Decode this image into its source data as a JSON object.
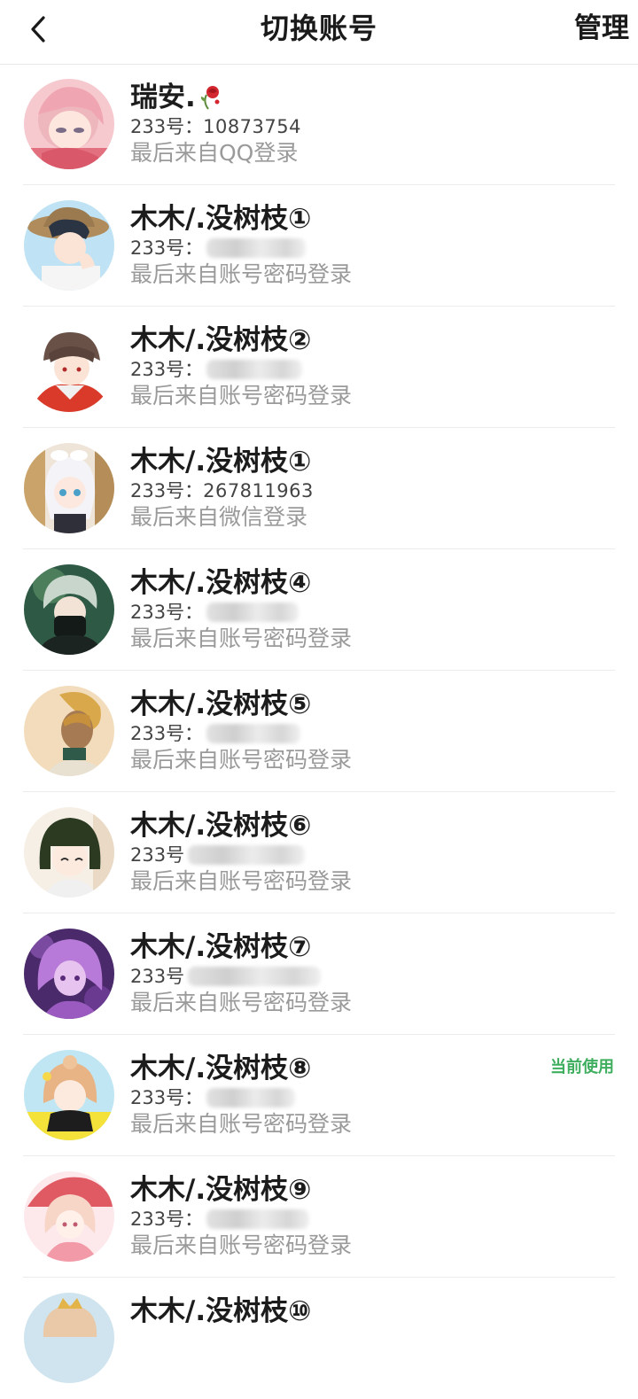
{
  "header": {
    "title": "切换账号",
    "manage_label": "管理",
    "back_icon": "chevron-left-icon"
  },
  "accounts": [
    {
      "name": "瑞安.",
      "name_icon": "rose-icon",
      "uid_label": "233号：",
      "uid": "10873754",
      "uid_masked": false,
      "source": "最后来自QQ登录",
      "avatar": "pink-hair-anime-avatar"
    },
    {
      "name": "木木/.没树枝①",
      "uid_label": "233号：",
      "uid": "",
      "uid_masked": true,
      "source": "最后来自账号密码登录",
      "avatar": "straw-hat-anime-avatar"
    },
    {
      "name": "木木/.没树枝②",
      "uid_label": "233号：",
      "uid": "",
      "uid_masked": true,
      "source": "最后来自账号密码登录",
      "avatar": "red-jacket-anime-avatar"
    },
    {
      "name": "木木/.没树枝①",
      "uid_label": "233号：",
      "uid": "267811963",
      "uid_masked": false,
      "source": "最后来自微信登录",
      "avatar": "white-hair-anime-avatar"
    },
    {
      "name": "木木/.没树枝④",
      "uid_label": "233号：",
      "uid": "",
      "uid_masked": true,
      "source": "最后来自账号密码登录",
      "avatar": "masked-ninja-anime-avatar"
    },
    {
      "name": "木木/.没树枝⑤",
      "uid_label": "233号：",
      "uid": "",
      "uid_masked": true,
      "source": "最后来自账号密码登录",
      "avatar": "blonde-profile-anime-avatar"
    },
    {
      "name": "木木/.没树枝⑥",
      "uid_label": "233号",
      "uid": "",
      "uid_masked": true,
      "source": "最后来自账号密码登录",
      "avatar": "bob-hair-anime-avatar"
    },
    {
      "name": "木木/.没树枝⑦",
      "uid_label": "233号",
      "uid": "",
      "uid_masked": true,
      "source": "最后来自账号密码登录",
      "avatar": "purple-hair-anime-avatar"
    },
    {
      "name": "木木/.没树枝⑧",
      "uid_label": "233号：",
      "uid": "",
      "uid_masked": true,
      "source": "最后来自账号密码登录",
      "avatar": "flower-girl-anime-avatar",
      "badge": "当前使用"
    },
    {
      "name": "木木/.没树枝⑨",
      "uid_label": "233号：",
      "uid": "",
      "uid_masked": true,
      "source": "最后来自账号密码登录",
      "avatar": "umbrella-girl-anime-avatar"
    },
    {
      "name": "木木/.没树枝⑩",
      "uid_label": "",
      "uid": "",
      "uid_masked": false,
      "source": "",
      "avatar": "crowned-anime-avatar"
    }
  ],
  "colors": {
    "accent_green": "#3fae5f",
    "secondary_text": "#9a9a9a",
    "primary_text": "#1c1c1c",
    "divider": "#ececec"
  }
}
